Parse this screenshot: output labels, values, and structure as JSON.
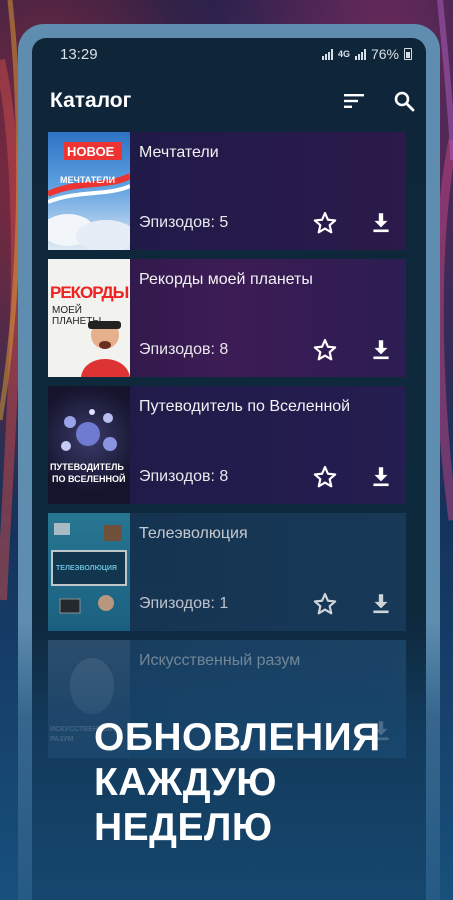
{
  "status_bar": {
    "time": "13:29",
    "network": "4G",
    "battery": "76%"
  },
  "toolbar": {
    "title": "Каталог",
    "sort_icon": "sort-icon",
    "search_icon": "search-icon"
  },
  "catalog": {
    "items": [
      {
        "title": "Мечтатели",
        "episodes": "Эпизодов: 5",
        "poster_lines": [
          "НОВОЕ",
          "МЕЧТАТЕЛИ"
        ]
      },
      {
        "title": "Рекорды моей планеты",
        "episodes": "Эпизодов: 8",
        "poster_lines": [
          "РЕКОРДЫ",
          "МОЕЙ ПЛАНЕТЫ"
        ]
      },
      {
        "title": "Путеводитель по Вселенной",
        "episodes": "Эпизодов: 8",
        "poster_lines": [
          "ПУТЕВОДИТЕЛЬ",
          "ПО ВСЕЛЕННОЙ"
        ]
      },
      {
        "title": "Телеэволюция",
        "episodes": "Эпизодов: 1",
        "poster_lines": [
          "ТЕЛЕЭВОЛЮЦИЯ"
        ]
      },
      {
        "title": "Искусственный разум",
        "episodes": "",
        "poster_lines": [
          "ИСКУССТВЕННЫЙ",
          "РАЗУМ"
        ]
      }
    ]
  },
  "promo": {
    "line1": "ОБНОВЛЕНИЯ",
    "line2": "КАЖДУЮ",
    "line3": "НЕДЕЛЮ"
  },
  "colors": {
    "accent": "#5e8db0",
    "card": "#1c1b45",
    "text": "#ffffff"
  }
}
